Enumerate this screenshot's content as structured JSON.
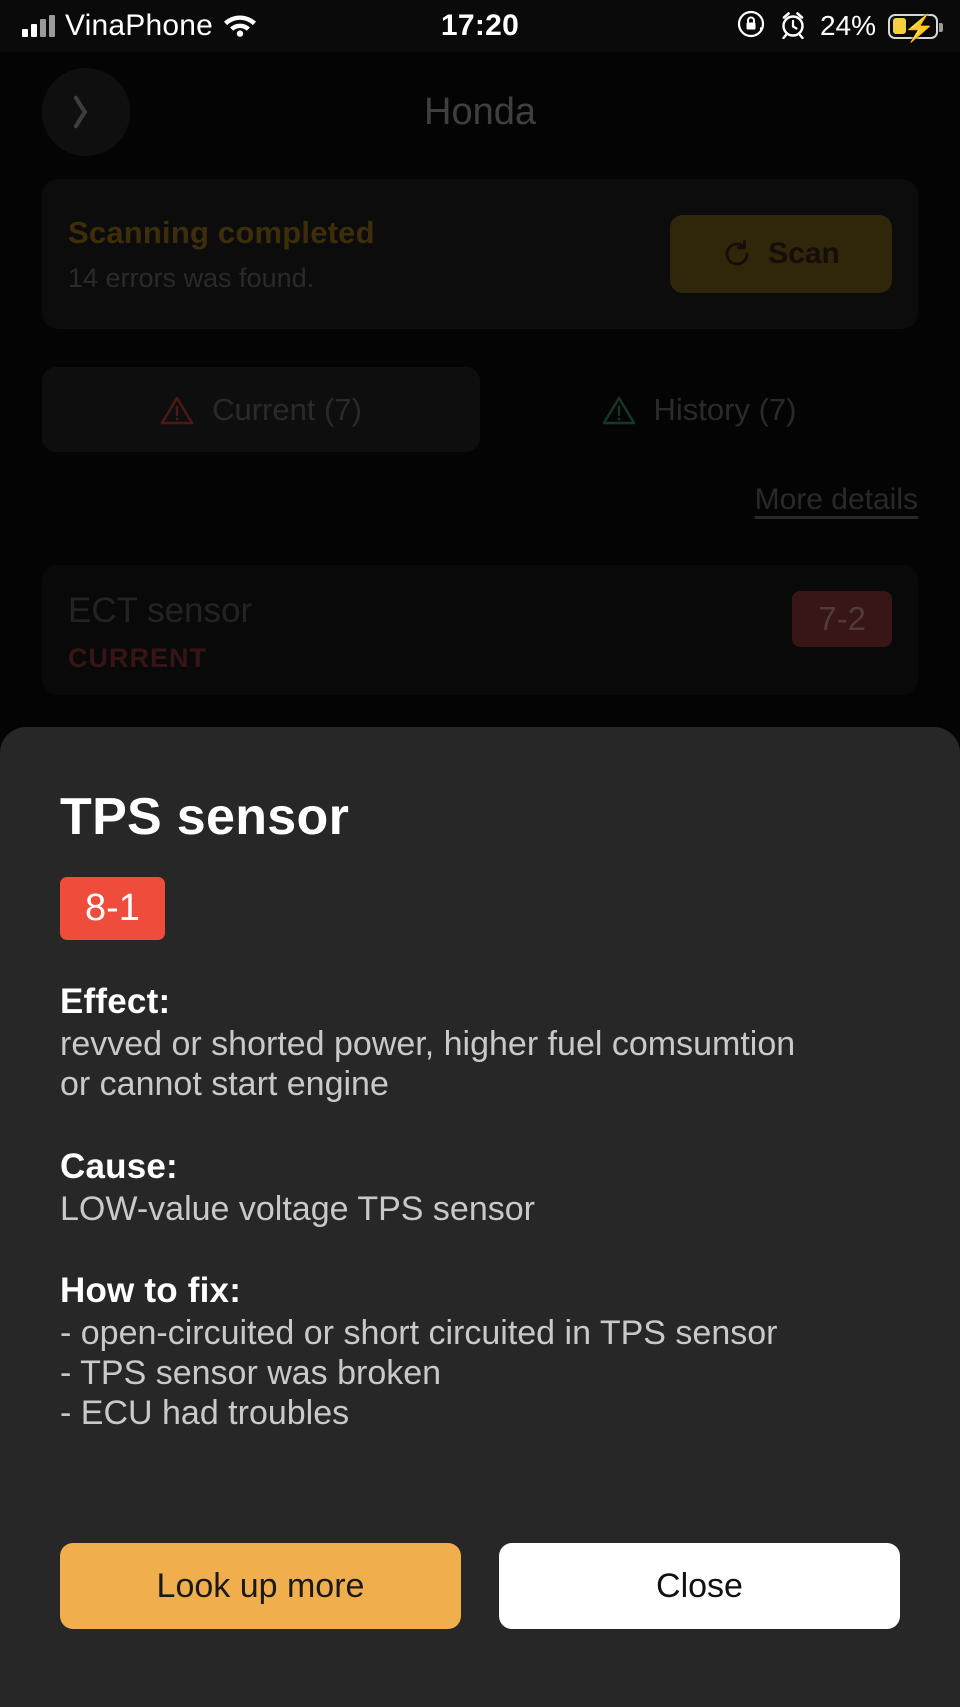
{
  "status_bar": {
    "carrier": "VinaPhone",
    "time": "17:20",
    "battery_percent": "24%",
    "icons": [
      "signal-bars-icon",
      "wifi-icon",
      "rotation-lock-icon",
      "alarm-clock-icon",
      "battery-charging-icon"
    ]
  },
  "nav": {
    "title": "Honda",
    "back_icon": "chevron-left-icon"
  },
  "scan_card": {
    "title": "Scanning completed",
    "subtitle": "14 errors was found.",
    "button_label": "Scan",
    "button_icon": "refresh-icon",
    "title_color": "#8a6514",
    "button_color": "#6b5418"
  },
  "tabs": [
    {
      "label": "Current (7)",
      "icon": "warning-triangle-red-icon",
      "icon_color": "#c0392b",
      "active": true
    },
    {
      "label": "History (7)",
      "icon": "warning-triangle-green-icon",
      "icon_color": "#2e7d52",
      "active": false
    }
  ],
  "more_details_label": "More details",
  "error_list": [
    {
      "name": "ECT sensor",
      "state": "CURRENT",
      "code": "7-2",
      "badge_color": "#7a3230"
    }
  ],
  "sheet": {
    "title": "TPS sensor",
    "code_badge": "8-1",
    "code_badge_color": "#ef4c3c",
    "sections": [
      {
        "heading": "Effect:",
        "lines": [
          "revved or shorted power, higher fuel comsumtion",
          "or cannot start engine"
        ]
      },
      {
        "heading": "Cause:",
        "lines": [
          "LOW-value voltage TPS sensor"
        ]
      },
      {
        "heading": "How to fix:",
        "lines": [
          "- open-circuited or short circuited in TPS sensor",
          "- TPS sensor was broken",
          "- ECU had troubles"
        ]
      }
    ],
    "primary_button": "Look up more",
    "secondary_button": "Close"
  }
}
